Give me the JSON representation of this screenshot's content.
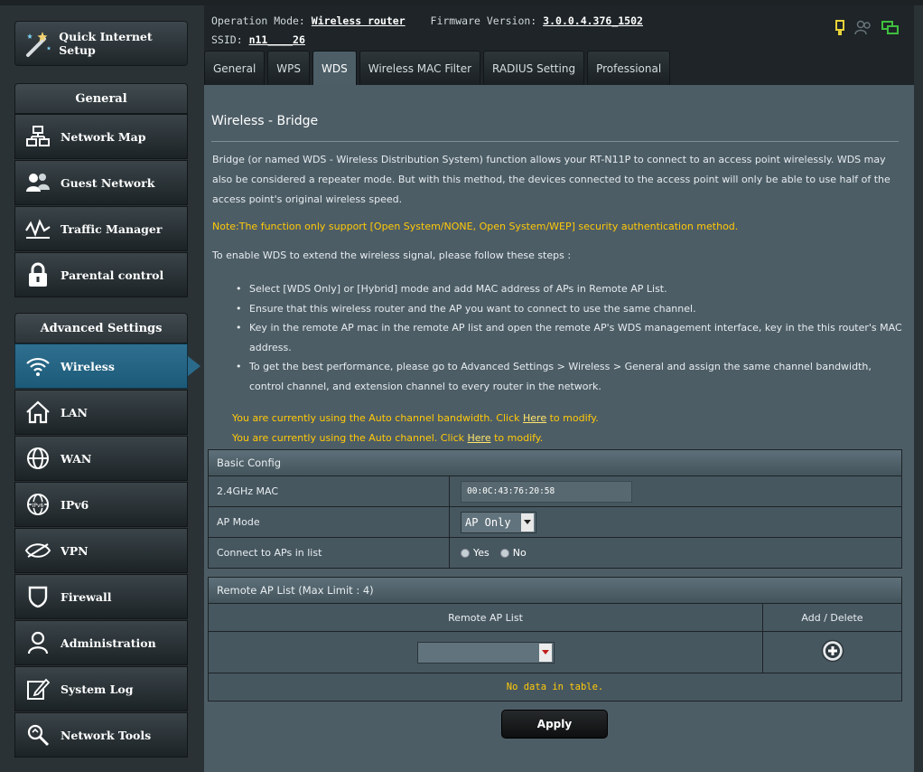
{
  "sidebar": {
    "quick_setup": "Quick Internet Setup",
    "general_header": "General",
    "general_items": [
      {
        "label": "Network Map"
      },
      {
        "label": "Guest Network"
      },
      {
        "label": "Traffic Manager"
      },
      {
        "label": "Parental control"
      }
    ],
    "advanced_header": "Advanced Settings",
    "advanced_items": [
      {
        "label": "Wireless",
        "active": true
      },
      {
        "label": "LAN"
      },
      {
        "label": "WAN"
      },
      {
        "label": "IPv6"
      },
      {
        "label": "VPN"
      },
      {
        "label": "Firewall"
      },
      {
        "label": "Administration"
      },
      {
        "label": "System Log"
      },
      {
        "label": "Network Tools"
      }
    ]
  },
  "header": {
    "op_mode_label": "Operation Mode:",
    "op_mode_value": "Wireless router",
    "firmware_label": "Firmware Version:",
    "firmware_value": "3.0.0.4.376_1502",
    "ssid_label": "SSID:",
    "ssid_value": "n11____26"
  },
  "tabs": [
    {
      "label": "General"
    },
    {
      "label": "WPS"
    },
    {
      "label": "WDS",
      "active": true
    },
    {
      "label": "Wireless MAC Filter"
    },
    {
      "label": "RADIUS Setting"
    },
    {
      "label": "Professional"
    }
  ],
  "page": {
    "title": "Wireless - Bridge",
    "description": "Bridge (or named WDS - Wireless Distribution System) function allows your RT-N11P to connect to an access point wirelessly. WDS may also be considered a repeater mode. But with this method, the devices connected to the access point will only be able to use half of the access point's original wireless speed.",
    "note": "Note:The function only support [Open System/NONE, Open System/WEP] security authentication method.",
    "steps_intro": "To enable WDS to extend the wireless signal, please follow these steps :",
    "steps": [
      "Select [WDS Only] or [Hybrid] mode and add MAC address of APs in Remote AP List.",
      "Ensure that this wireless router and the AP you want to connect to use the same channel.",
      "Key in the remote AP mac in the remote AP list and open the remote AP's WDS management interface, key in the this router's MAC address.",
      "To get the best performance, please go to Advanced Settings > Wireless > General and assign the same channel bandwidth, control channel, and extension channel to every router in the network."
    ],
    "warn1_pre": "You are currently using the Auto channel bandwidth. Click ",
    "warn1_link": "Here",
    "warn1_post": " to modify.",
    "warn2_pre": "You are currently using the Auto channel. Click ",
    "warn2_link": "Here",
    "warn2_post": " to modify."
  },
  "basic_config": {
    "header": "Basic Config",
    "mac_label": "2.4GHz MAC",
    "mac_value": "00:0C:43:76:20:58",
    "ap_mode_label": "AP Mode",
    "ap_mode_value": "AP Only",
    "connect_label": "Connect to APs in list",
    "yes_label": "Yes",
    "no_label": "No"
  },
  "remote_list": {
    "header": "Remote AP List (Max Limit : 4)",
    "col_list": "Remote AP List",
    "col_action": "Add / Delete",
    "empty_text": "No data in table."
  },
  "apply_label": "Apply",
  "colors": {
    "accent": "#2f6f8f",
    "warning": "#ffc907",
    "content_bg": "#4d5d66"
  }
}
